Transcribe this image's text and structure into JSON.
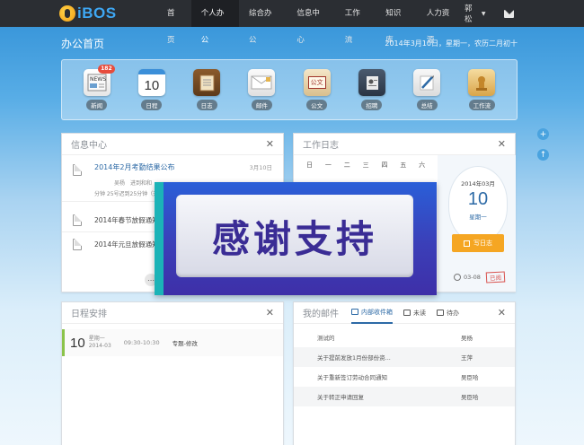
{
  "brand": {
    "logo_text": "iBOS"
  },
  "nav": {
    "items": [
      "首页",
      "个人办公",
      "综合办公",
      "信息中心",
      "工作流",
      "知识库",
      "人力资源"
    ],
    "active_index": 1,
    "user": "郭松"
  },
  "page": {
    "title": "办公首页",
    "date": "2014年3月10日，星期一，农历二月初十"
  },
  "apps": [
    {
      "label": "新闻",
      "icon": "news-icon",
      "badge": "182"
    },
    {
      "label": "日程",
      "icon": "calendar-icon",
      "day": "10"
    },
    {
      "label": "日志",
      "icon": "diary-icon"
    },
    {
      "label": "邮件",
      "icon": "mail-icon"
    },
    {
      "label": "公文",
      "icon": "document-icon",
      "icon_text": "公文"
    },
    {
      "label": "招聘",
      "icon": "recruit-icon"
    },
    {
      "label": "总结",
      "icon": "summary-icon"
    },
    {
      "label": "工作流",
      "icon": "workflow-icon"
    }
  ],
  "info_center": {
    "title": "信息中心",
    "featured": {
      "title": "2014年2月考勤结果公布",
      "date": "3月10日",
      "author": "吴杨",
      "snippet_1": "进到和和",
      "snippet_2": "分钟 25号迟到25分钟（天"
    },
    "items": [
      "2014年春节放假通知",
      "2014年元旦放假通知"
    ]
  },
  "work_log": {
    "title": "工作日志",
    "weekdays": [
      "日",
      "一",
      "二",
      "三",
      "四",
      "五",
      "六"
    ],
    "date_card": {
      "year_month": "2014年03月",
      "day": "10",
      "weekday": "星期一"
    },
    "write_label": "写日志",
    "foot_date": "03-08",
    "stamp": "已阅"
  },
  "schedule": {
    "title": "日程安排",
    "entry": {
      "day": "10",
      "weekday": "星期一",
      "year_month": "2014-03",
      "time": "09:30-10:30",
      "title": "专题-修改"
    }
  },
  "mail": {
    "title": "我的邮件",
    "tabs": [
      "内部收件箱",
      "未读",
      "待办"
    ],
    "rows": [
      {
        "subject": "测试的",
        "from": "吴杨"
      },
      {
        "subject": "关于提前发放1月份部份资...",
        "from": "王萍"
      },
      {
        "subject": "关于重新签订劳动合同通知",
        "from": "吴臣哈"
      },
      {
        "subject": "关于转正申请回复",
        "from": "吴臣哈"
      }
    ]
  },
  "overlay": {
    "text": "感谢支持"
  }
}
